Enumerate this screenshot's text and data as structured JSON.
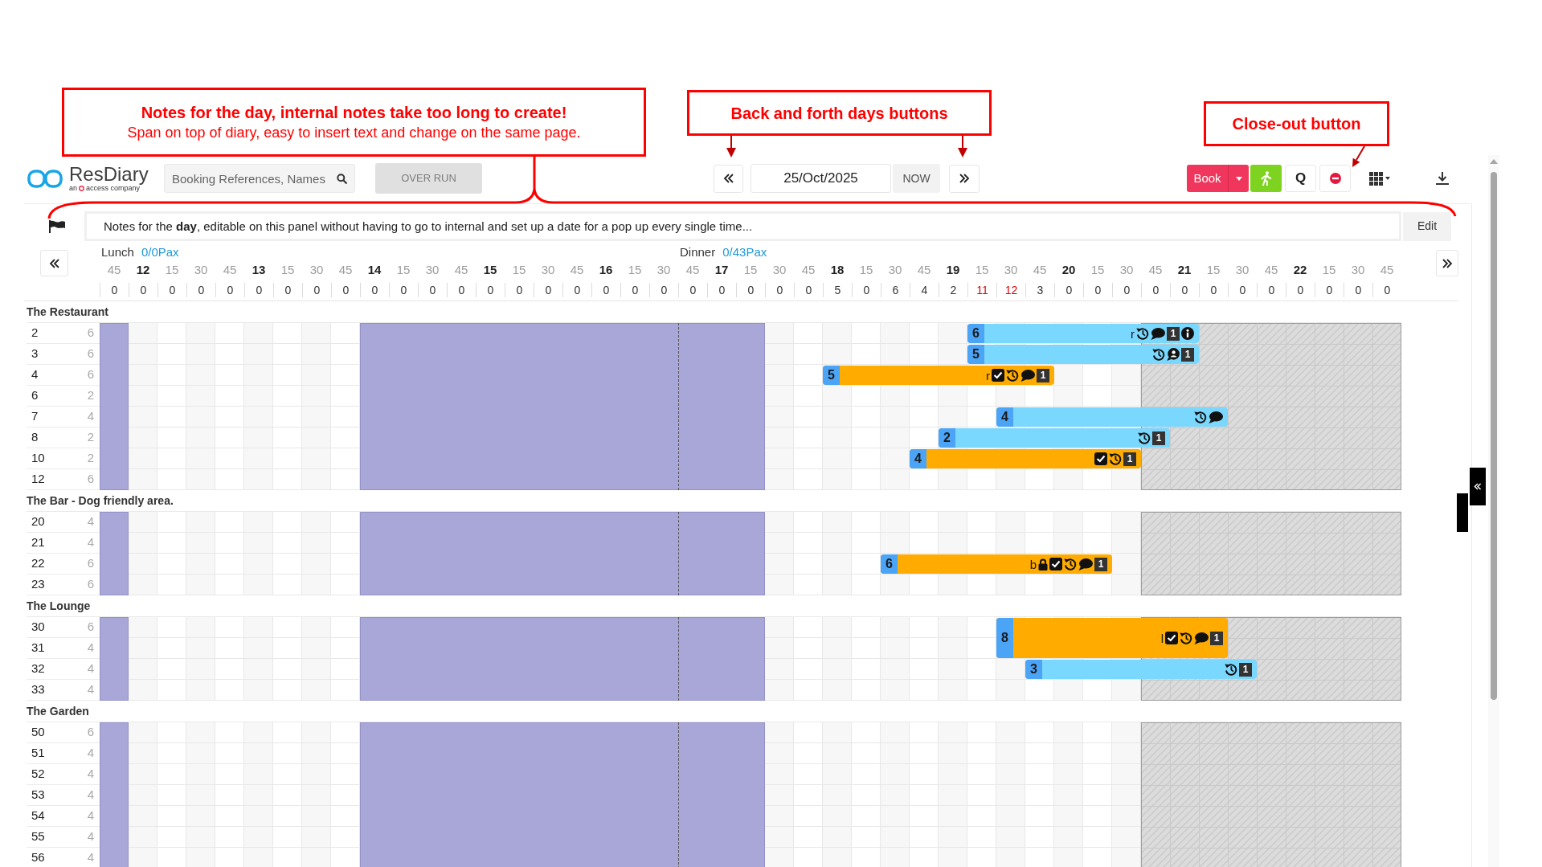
{
  "annotations": [
    {
      "title": "Notes for the day, internal notes take too long to create!",
      "text": "Span on top of diary, easy to insert text and change on the same page."
    },
    {
      "title": "Back and forth days buttons"
    },
    {
      "title": "Close-out button"
    }
  ],
  "header": {
    "logo": {
      "name": "ResDiary",
      "tagline_prefix": "an",
      "tagline": "access company"
    },
    "search": {
      "placeholder": "Booking References, Names"
    },
    "overrun_button": {
      "label": "OVER RUN",
      "disabled": true
    },
    "date": "25/Oct/2025",
    "now_button": "NOW",
    "book_button": "Book",
    "q_button": "Q"
  },
  "notes": {
    "text": "Notes for the **day**, editable on this panel without having to go to internal and set up a date for a pop up every single time...",
    "edit_button": "Edit"
  },
  "timeline": {
    "shifts": [
      {
        "name": "Lunch",
        "pax": "0/0Pax"
      },
      {
        "name": "Dinner",
        "pax": "0/43Pax"
      }
    ],
    "slots": [
      {
        "label": "45",
        "kind": "quarter",
        "count": "0",
        "over_capacity": false,
        "closed": true,
        "unavailable": false
      },
      {
        "label": "12",
        "kind": "hour",
        "count": "0",
        "over_capacity": false,
        "closed": false,
        "unavailable": false
      },
      {
        "label": "15",
        "kind": "quarter",
        "count": "0",
        "over_capacity": false,
        "closed": false,
        "unavailable": false
      },
      {
        "label": "30",
        "kind": "quarter",
        "count": "0",
        "over_capacity": false,
        "closed": false,
        "unavailable": false
      },
      {
        "label": "45",
        "kind": "quarter",
        "count": "0",
        "over_capacity": false,
        "closed": false,
        "unavailable": false
      },
      {
        "label": "13",
        "kind": "hour",
        "count": "0",
        "over_capacity": false,
        "closed": false,
        "unavailable": false
      },
      {
        "label": "15",
        "kind": "quarter",
        "count": "0",
        "over_capacity": false,
        "closed": false,
        "unavailable": false
      },
      {
        "label": "30",
        "kind": "quarter",
        "count": "0",
        "over_capacity": false,
        "closed": false,
        "unavailable": false
      },
      {
        "label": "45",
        "kind": "quarter",
        "count": "0",
        "over_capacity": false,
        "closed": false,
        "unavailable": false
      },
      {
        "label": "14",
        "kind": "hour",
        "count": "0",
        "over_capacity": false,
        "closed": true,
        "unavailable": false
      },
      {
        "label": "15",
        "kind": "quarter",
        "count": "0",
        "over_capacity": false,
        "closed": true,
        "unavailable": false
      },
      {
        "label": "30",
        "kind": "quarter",
        "count": "0",
        "over_capacity": false,
        "closed": true,
        "unavailable": false
      },
      {
        "label": "45",
        "kind": "quarter",
        "count": "0",
        "over_capacity": false,
        "closed": true,
        "unavailable": false
      },
      {
        "label": "15",
        "kind": "hour",
        "count": "0",
        "over_capacity": false,
        "closed": true,
        "unavailable": false
      },
      {
        "label": "15",
        "kind": "quarter",
        "count": "0",
        "over_capacity": false,
        "closed": true,
        "unavailable": false
      },
      {
        "label": "30",
        "kind": "quarter",
        "count": "0",
        "over_capacity": false,
        "closed": true,
        "unavailable": false
      },
      {
        "label": "45",
        "kind": "quarter",
        "count": "0",
        "over_capacity": false,
        "closed": true,
        "unavailable": false
      },
      {
        "label": "16",
        "kind": "hour",
        "count": "0",
        "over_capacity": false,
        "closed": true,
        "unavailable": false
      },
      {
        "label": "15",
        "kind": "quarter",
        "count": "0",
        "over_capacity": false,
        "closed": true,
        "unavailable": false
      },
      {
        "label": "30",
        "kind": "quarter",
        "count": "0",
        "over_capacity": false,
        "closed": true,
        "unavailable": false
      },
      {
        "label": "45",
        "kind": "quarter",
        "count": "0",
        "over_capacity": false,
        "closed": true,
        "unavailable": false
      },
      {
        "label": "17",
        "kind": "hour",
        "count": "0",
        "over_capacity": false,
        "closed": true,
        "unavailable": false
      },
      {
        "label": "15",
        "kind": "quarter",
        "count": "0",
        "over_capacity": false,
        "closed": true,
        "unavailable": false
      },
      {
        "label": "30",
        "kind": "quarter",
        "count": "0",
        "over_capacity": false,
        "closed": false,
        "unavailable": false
      },
      {
        "label": "45",
        "kind": "quarter",
        "count": "0",
        "over_capacity": false,
        "closed": false,
        "unavailable": false
      },
      {
        "label": "18",
        "kind": "hour",
        "count": "5",
        "over_capacity": false,
        "closed": false,
        "unavailable": false
      },
      {
        "label": "15",
        "kind": "quarter",
        "count": "0",
        "over_capacity": false,
        "closed": false,
        "unavailable": false
      },
      {
        "label": "30",
        "kind": "quarter",
        "count": "6",
        "over_capacity": false,
        "closed": false,
        "unavailable": false
      },
      {
        "label": "45",
        "kind": "quarter",
        "count": "4",
        "over_capacity": false,
        "closed": false,
        "unavailable": false
      },
      {
        "label": "19",
        "kind": "hour",
        "count": "2",
        "over_capacity": false,
        "closed": false,
        "unavailable": false
      },
      {
        "label": "15",
        "kind": "quarter",
        "count": "11",
        "over_capacity": true,
        "closed": false,
        "unavailable": false
      },
      {
        "label": "30",
        "kind": "quarter",
        "count": "12",
        "over_capacity": true,
        "closed": false,
        "unavailable": false
      },
      {
        "label": "45",
        "kind": "quarter",
        "count": "3",
        "over_capacity": false,
        "closed": false,
        "unavailable": false
      },
      {
        "label": "20",
        "kind": "hour",
        "count": "0",
        "over_capacity": false,
        "closed": false,
        "unavailable": false
      },
      {
        "label": "15",
        "kind": "quarter",
        "count": "0",
        "over_capacity": false,
        "closed": false,
        "unavailable": false
      },
      {
        "label": "30",
        "kind": "quarter",
        "count": "0",
        "over_capacity": false,
        "closed": false,
        "unavailable": false
      },
      {
        "label": "45",
        "kind": "quarter",
        "count": "0",
        "over_capacity": false,
        "closed": false,
        "unavailable": true
      },
      {
        "label": "21",
        "kind": "hour",
        "count": "0",
        "over_capacity": false,
        "closed": false,
        "unavailable": true
      },
      {
        "label": "15",
        "kind": "quarter",
        "count": "0",
        "over_capacity": false,
        "closed": false,
        "unavailable": true
      },
      {
        "label": "30",
        "kind": "quarter",
        "count": "0",
        "over_capacity": false,
        "closed": false,
        "unavailable": true
      },
      {
        "label": "45",
        "kind": "quarter",
        "count": "0",
        "over_capacity": false,
        "closed": false,
        "unavailable": true
      },
      {
        "label": "22",
        "kind": "hour",
        "count": "0",
        "over_capacity": false,
        "closed": false,
        "unavailable": true
      },
      {
        "label": "15",
        "kind": "quarter",
        "count": "0",
        "over_capacity": false,
        "closed": false,
        "unavailable": true
      },
      {
        "label": "30",
        "kind": "quarter",
        "count": "0",
        "over_capacity": false,
        "closed": false,
        "unavailable": true
      },
      {
        "label": "45",
        "kind": "quarter",
        "count": "0",
        "over_capacity": false,
        "closed": false,
        "unavailable": true
      }
    ]
  },
  "sections": [
    {
      "name": "The Restaurant",
      "tables": [
        {
          "number": "2",
          "covers": "6",
          "bookings": [
            {
              "party": "6",
              "color": "#7ad7fd",
              "joined_with_next": false,
              "marks": [
                {
                  "kind": "letter",
                  "text": "r"
                },
                {
                  "kind": "history"
                },
                {
                  "kind": "comment"
                },
                {
                  "kind": "number",
                  "text": "1"
                },
                {
                  "kind": "info"
                }
              ]
            }
          ]
        },
        {
          "number": "3",
          "covers": "6",
          "bookings": [
            {
              "party": "5",
              "color": "#7ad7fd",
              "joined_with_next": false,
              "marks": [
                {
                  "kind": "history"
                },
                {
                  "kind": "guest"
                },
                {
                  "kind": "number",
                  "text": "1"
                }
              ]
            }
          ]
        },
        {
          "number": "4",
          "covers": "6",
          "bookings": [
            {
              "party": "5",
              "color": "#ffab00",
              "joined_with_next": false,
              "marks": [
                {
                  "kind": "letter",
                  "text": "r"
                },
                {
                  "kind": "tick"
                },
                {
                  "kind": "history"
                },
                {
                  "kind": "comment"
                },
                {
                  "kind": "number",
                  "text": "1"
                }
              ]
            }
          ]
        },
        {
          "number": "6",
          "covers": "2"
        },
        {
          "number": "7",
          "covers": "4",
          "bookings": [
            {
              "party": "4",
              "color": "#7ad7fd",
              "joined_with_next": false,
              "marks": [
                {
                  "kind": "history"
                },
                {
                  "kind": "comment"
                }
              ]
            }
          ]
        },
        {
          "number": "8",
          "covers": "2",
          "bookings": [
            {
              "party": "2",
              "color": "#7ad7fd",
              "joined_with_next": false,
              "marks": [
                {
                  "kind": "history"
                },
                {
                  "kind": "number",
                  "text": "1"
                }
              ]
            }
          ]
        },
        {
          "number": "10",
          "covers": "2",
          "bookings": [
            {
              "party": "4",
              "color": "#ffab00",
              "joined_with_next": false,
              "marks": [
                {
                  "kind": "tick"
                },
                {
                  "kind": "history"
                },
                {
                  "kind": "number",
                  "text": "1"
                }
              ]
            }
          ]
        },
        {
          "number": "12",
          "covers": "6"
        }
      ]
    },
    {
      "name": "The Bar - Dog friendly area.",
      "tables": [
        {
          "number": "20",
          "covers": "4"
        },
        {
          "number": "21",
          "covers": "4"
        },
        {
          "number": "22",
          "covers": "6",
          "bookings": [
            {
              "party": "6",
              "color": "#ffab00",
              "joined_with_next": false,
              "marks": [
                {
                  "kind": "letter",
                  "text": "b"
                },
                {
                  "kind": "lock"
                },
                {
                  "kind": "tick"
                },
                {
                  "kind": "history"
                },
                {
                  "kind": "comment"
                },
                {
                  "kind": "number",
                  "text": "1"
                }
              ]
            }
          ]
        },
        {
          "number": "23",
          "covers": "6"
        }
      ]
    },
    {
      "name": "The Lounge",
      "tables": [
        {
          "number": "30",
          "covers": "6",
          "bookings": [
            {
              "party": "8",
              "color": "#ffab00",
              "joined_with_next": true,
              "marks": [
                {
                  "kind": "letter",
                  "text": "l"
                },
                {
                  "kind": "tick"
                },
                {
                  "kind": "history"
                },
                {
                  "kind": "comment"
                },
                {
                  "kind": "number",
                  "text": "1"
                }
              ]
            }
          ]
        },
        {
          "number": "31",
          "covers": "4"
        },
        {
          "number": "32",
          "covers": "4",
          "bookings": [
            {
              "party": "3",
              "color": "#7ad7fd",
              "joined_with_next": false,
              "marks": [
                {
                  "kind": "history"
                },
                {
                  "kind": "number",
                  "text": "1"
                }
              ]
            }
          ]
        },
        {
          "number": "33",
          "covers": "4"
        }
      ]
    },
    {
      "name": "The Garden",
      "tables": [
        {
          "number": "50",
          "covers": "6"
        },
        {
          "number": "51",
          "covers": "4"
        },
        {
          "number": "52",
          "covers": "4"
        },
        {
          "number": "53",
          "covers": "4"
        },
        {
          "number": "54",
          "covers": "4"
        },
        {
          "number": "55",
          "covers": "4"
        },
        {
          "number": "56",
          "covers": "4"
        }
      ]
    }
  ]
}
